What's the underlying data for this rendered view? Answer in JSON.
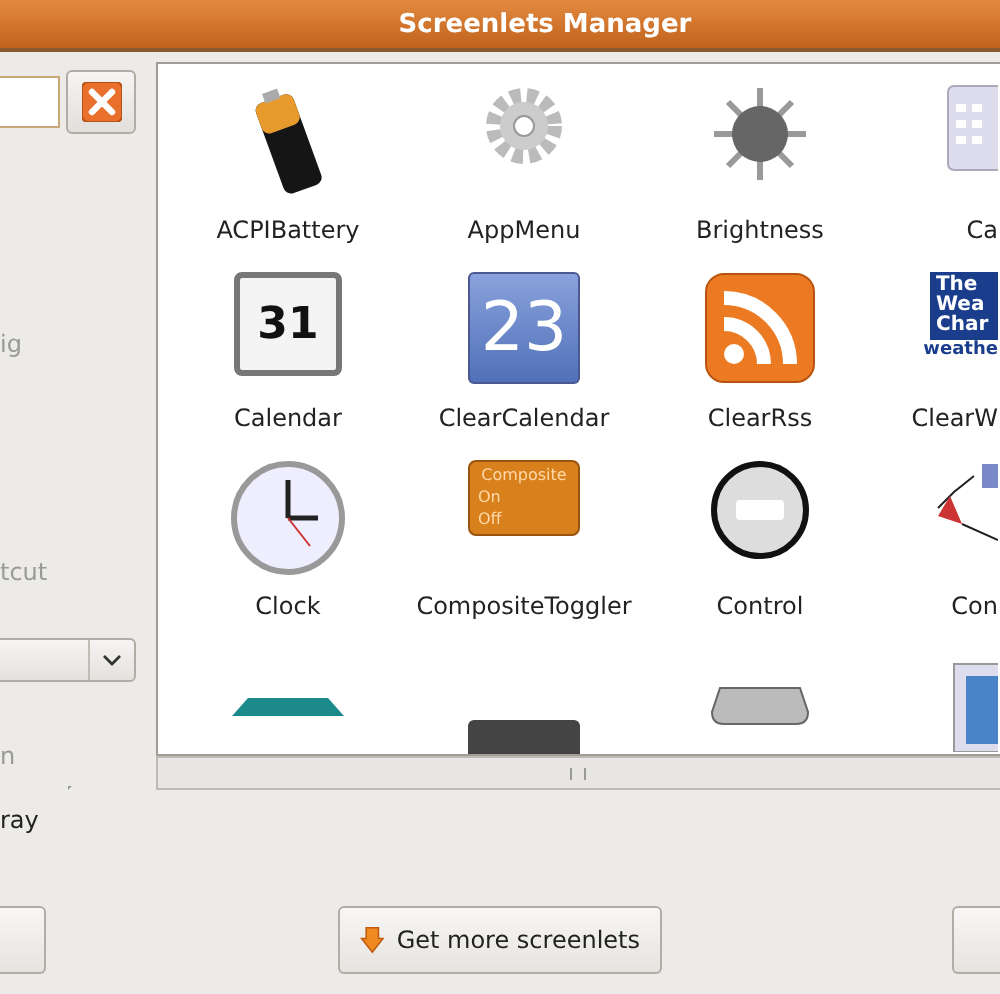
{
  "window": {
    "title": "Screenlets Manager"
  },
  "sidebar": [
    {
      "kind": "label",
      "label": "ig",
      "disabled": true
    },
    {
      "kind": "label",
      "label": "tcut",
      "disabled": true
    },
    {
      "kind": "dropdown"
    },
    {
      "kind": "label",
      "label": "n",
      "disabled": true
    },
    {
      "kind": "separator"
    },
    {
      "kind": "label",
      "label": "ray",
      "disabled": false
    }
  ],
  "screenlets": [
    {
      "kind": "battery",
      "label": "ACPIBattery"
    },
    {
      "kind": "gear",
      "label": "AppMenu"
    },
    {
      "kind": "sun",
      "label": "Brightness"
    },
    {
      "kind": "calculator",
      "label": "Ca"
    },
    {
      "kind": "calendar",
      "label": "Calendar",
      "icon_text": "31"
    },
    {
      "kind": "bluecal",
      "label": "ClearCalendar",
      "icon_text": "23"
    },
    {
      "kind": "rss",
      "label": "ClearRss"
    },
    {
      "kind": "weather",
      "label": "ClearW",
      "icon_lines": [
        "The",
        "Wea",
        "Char",
        "weathe"
      ]
    },
    {
      "kind": "clock",
      "label": "Clock"
    },
    {
      "kind": "toggle",
      "label": "CompositeToggler",
      "icon_lines": [
        "Composite",
        "On",
        "Off"
      ]
    },
    {
      "kind": "minus",
      "label": "Control"
    },
    {
      "kind": "network",
      "label": "Con"
    },
    {
      "kind": "teal"
    },
    {
      "kind": "digital"
    },
    {
      "kind": "drive"
    },
    {
      "kind": "photo"
    }
  ],
  "buttons": [
    {
      "kind": "plain"
    },
    {
      "kind": "download",
      "label": "Get more screenlets"
    },
    {
      "kind": "plain"
    }
  ]
}
